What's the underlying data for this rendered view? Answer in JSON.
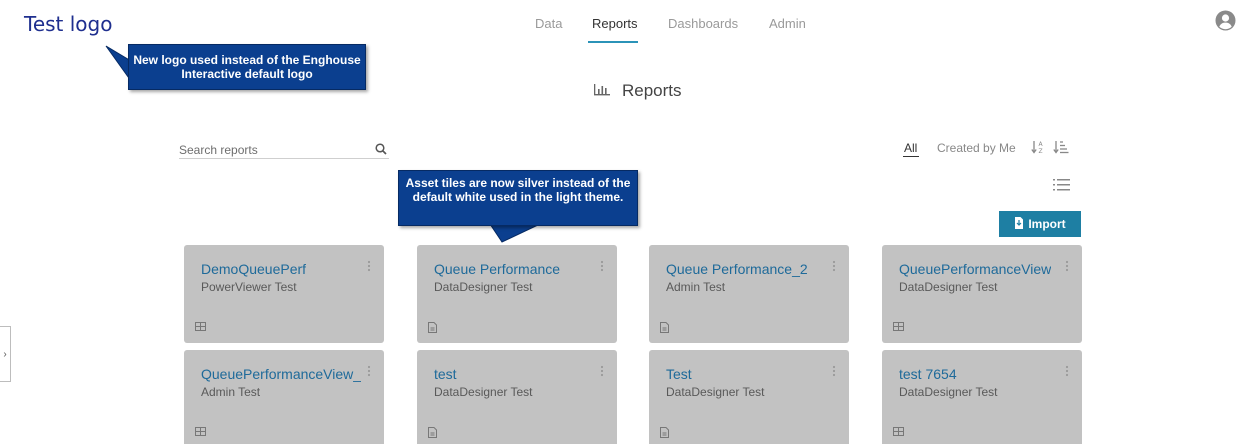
{
  "logo": {
    "text": "Test logo"
  },
  "nav": {
    "tabs": [
      {
        "label": "Data"
      },
      {
        "label": "Reports"
      },
      {
        "label": "Dashboards"
      },
      {
        "label": "Admin"
      }
    ],
    "active": "Reports"
  },
  "page": {
    "title": "Reports",
    "title_icon": "bar-chart-icon"
  },
  "search": {
    "placeholder": "Search reports"
  },
  "filters": {
    "all": "All",
    "created_by_me": "Created by Me"
  },
  "import_label": "Import",
  "callouts": [
    {
      "text": "New logo used instead of the Enghouse Interactive default logo"
    },
    {
      "text": "Asset tiles are now silver instead of the default white used in the light theme."
    }
  ],
  "tiles": [
    {
      "title": "DemoQueuePerf",
      "subtitle": "PowerViewer Test",
      "type_icon": "table-icon"
    },
    {
      "title": "Queue Performance",
      "subtitle": "DataDesigner Test",
      "type_icon": "document-icon"
    },
    {
      "title": "Queue Performance_2",
      "subtitle": "Admin Test",
      "type_icon": "document-icon"
    },
    {
      "title": "QueuePerformanceView",
      "subtitle": "DataDesigner Test",
      "type_icon": "table-icon"
    },
    {
      "title": "QueuePerformanceView_",
      "subtitle": "Admin Test",
      "type_icon": "table-icon"
    },
    {
      "title": "test",
      "subtitle": "DataDesigner Test",
      "type_icon": "document-icon"
    },
    {
      "title": "Test",
      "subtitle": "DataDesigner Test",
      "type_icon": "document-icon"
    },
    {
      "title": "test 7654",
      "subtitle": "DataDesigner Test",
      "type_icon": "table-icon"
    }
  ],
  "colors": {
    "accent": "#1e7fa3",
    "tile_bg": "#c2c2c2",
    "tile_title": "#1e6a9a",
    "callout_bg": "#0b3f8f",
    "logo": "#1f2f8f"
  }
}
